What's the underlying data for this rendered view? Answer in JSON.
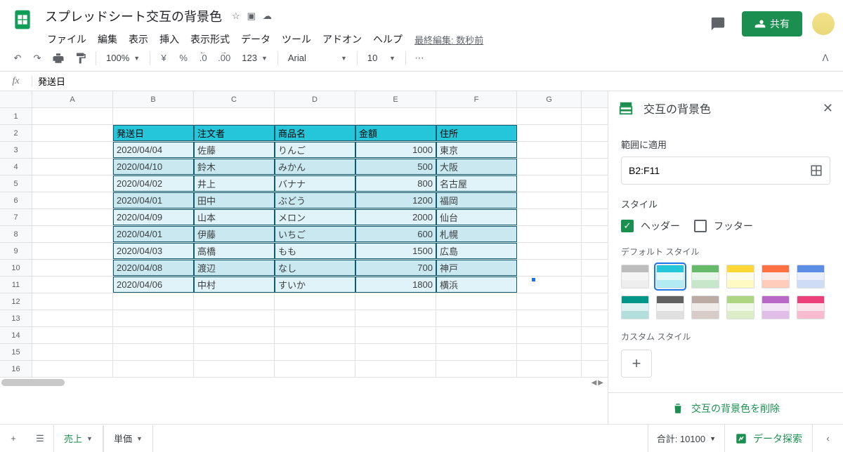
{
  "doc": {
    "title": "スプレッドシート交互の背景色",
    "last_edit": "最終編集: 数秒前"
  },
  "menu": [
    "ファイル",
    "編集",
    "表示",
    "挿入",
    "表示形式",
    "データ",
    "ツール",
    "アドオン",
    "ヘルプ"
  ],
  "toolbar": {
    "zoom": "100%",
    "currency": "¥",
    "percent": "%",
    "dec_dec": ".0",
    "inc_dec": ".00",
    "fmt": "123",
    "font": "Arial",
    "size": "10"
  },
  "formula": {
    "value": "発送日"
  },
  "share": {
    "label": "共有"
  },
  "columns": [
    "A",
    "B",
    "C",
    "D",
    "E",
    "F",
    "G"
  ],
  "rows": [
    "1",
    "2",
    "3",
    "4",
    "5",
    "6",
    "7",
    "8",
    "9",
    "10",
    "11",
    "12",
    "13",
    "14",
    "15",
    "16"
  ],
  "table": {
    "headers": [
      "発送日",
      "注文者",
      "商品名",
      "金額",
      "住所"
    ],
    "rows": [
      [
        "2020/04/04",
        "佐藤",
        "りんご",
        "1000",
        "東京"
      ],
      [
        "2020/04/10",
        "鈴木",
        "みかん",
        "500",
        "大阪"
      ],
      [
        "2020/04/02",
        "井上",
        "バナナ",
        "800",
        "名古屋"
      ],
      [
        "2020/04/01",
        "田中",
        "ぶどう",
        "1200",
        "福岡"
      ],
      [
        "2020/04/09",
        "山本",
        "メロン",
        "2000",
        "仙台"
      ],
      [
        "2020/04/01",
        "伊藤",
        "いちご",
        "600",
        "札幌"
      ],
      [
        "2020/04/03",
        "高橋",
        "もも",
        "1500",
        "広島"
      ],
      [
        "2020/04/08",
        "渡辺",
        "なし",
        "700",
        "神戸"
      ],
      [
        "2020/04/06",
        "中村",
        "すいか",
        "1800",
        "横浜"
      ]
    ]
  },
  "panel": {
    "title": "交互の背景色",
    "range_label": "範囲に適用",
    "range_value": "B2:F11",
    "style_label": "スタイル",
    "header_chk": "ヘッダー",
    "footer_chk": "フッター",
    "default_label": "デフォルト スタイル",
    "custom_label": "カスタム スタイル",
    "remove": "交互の背景色を削除"
  },
  "tabs": {
    "active": "売上",
    "other": "単価"
  },
  "status": {
    "sum": "合計: 10100",
    "explore": "データ探索"
  },
  "swatches": [
    {
      "h": "#bdbdbd",
      "r1": "#f5f5f5",
      "r2": "#eeeeee",
      "sel": false
    },
    {
      "h": "#26c6da",
      "r1": "#e0f7fa",
      "r2": "#b2ebf2",
      "sel": true
    },
    {
      "h": "#66bb6a",
      "r1": "#e8f5e9",
      "r2": "#c8e6c9",
      "sel": false
    },
    {
      "h": "#fdd835",
      "r1": "#fffde7",
      "r2": "#fff9c4",
      "sel": false
    },
    {
      "h": "#ff7043",
      "r1": "#fbe9e7",
      "r2": "#ffccbc",
      "sel": false
    },
    {
      "h": "#5c8ee6",
      "r1": "#e8eefb",
      "r2": "#cfdcf5",
      "sel": false
    },
    {
      "h": "#009688",
      "r1": "#e0f2f1",
      "r2": "#b2dfdb",
      "sel": false
    },
    {
      "h": "#616161",
      "r1": "#f5f5f5",
      "r2": "#e0e0e0",
      "sel": false
    },
    {
      "h": "#bcaaa4",
      "r1": "#efebe9",
      "r2": "#d7ccc8",
      "sel": false
    },
    {
      "h": "#aed581",
      "r1": "#f1f8e9",
      "r2": "#dcedc8",
      "sel": false
    },
    {
      "h": "#ba68c8",
      "r1": "#f3e5f5",
      "r2": "#e1bee7",
      "sel": false
    },
    {
      "h": "#ec407a",
      "r1": "#fce4ec",
      "r2": "#f8bbd0",
      "sel": false
    }
  ]
}
